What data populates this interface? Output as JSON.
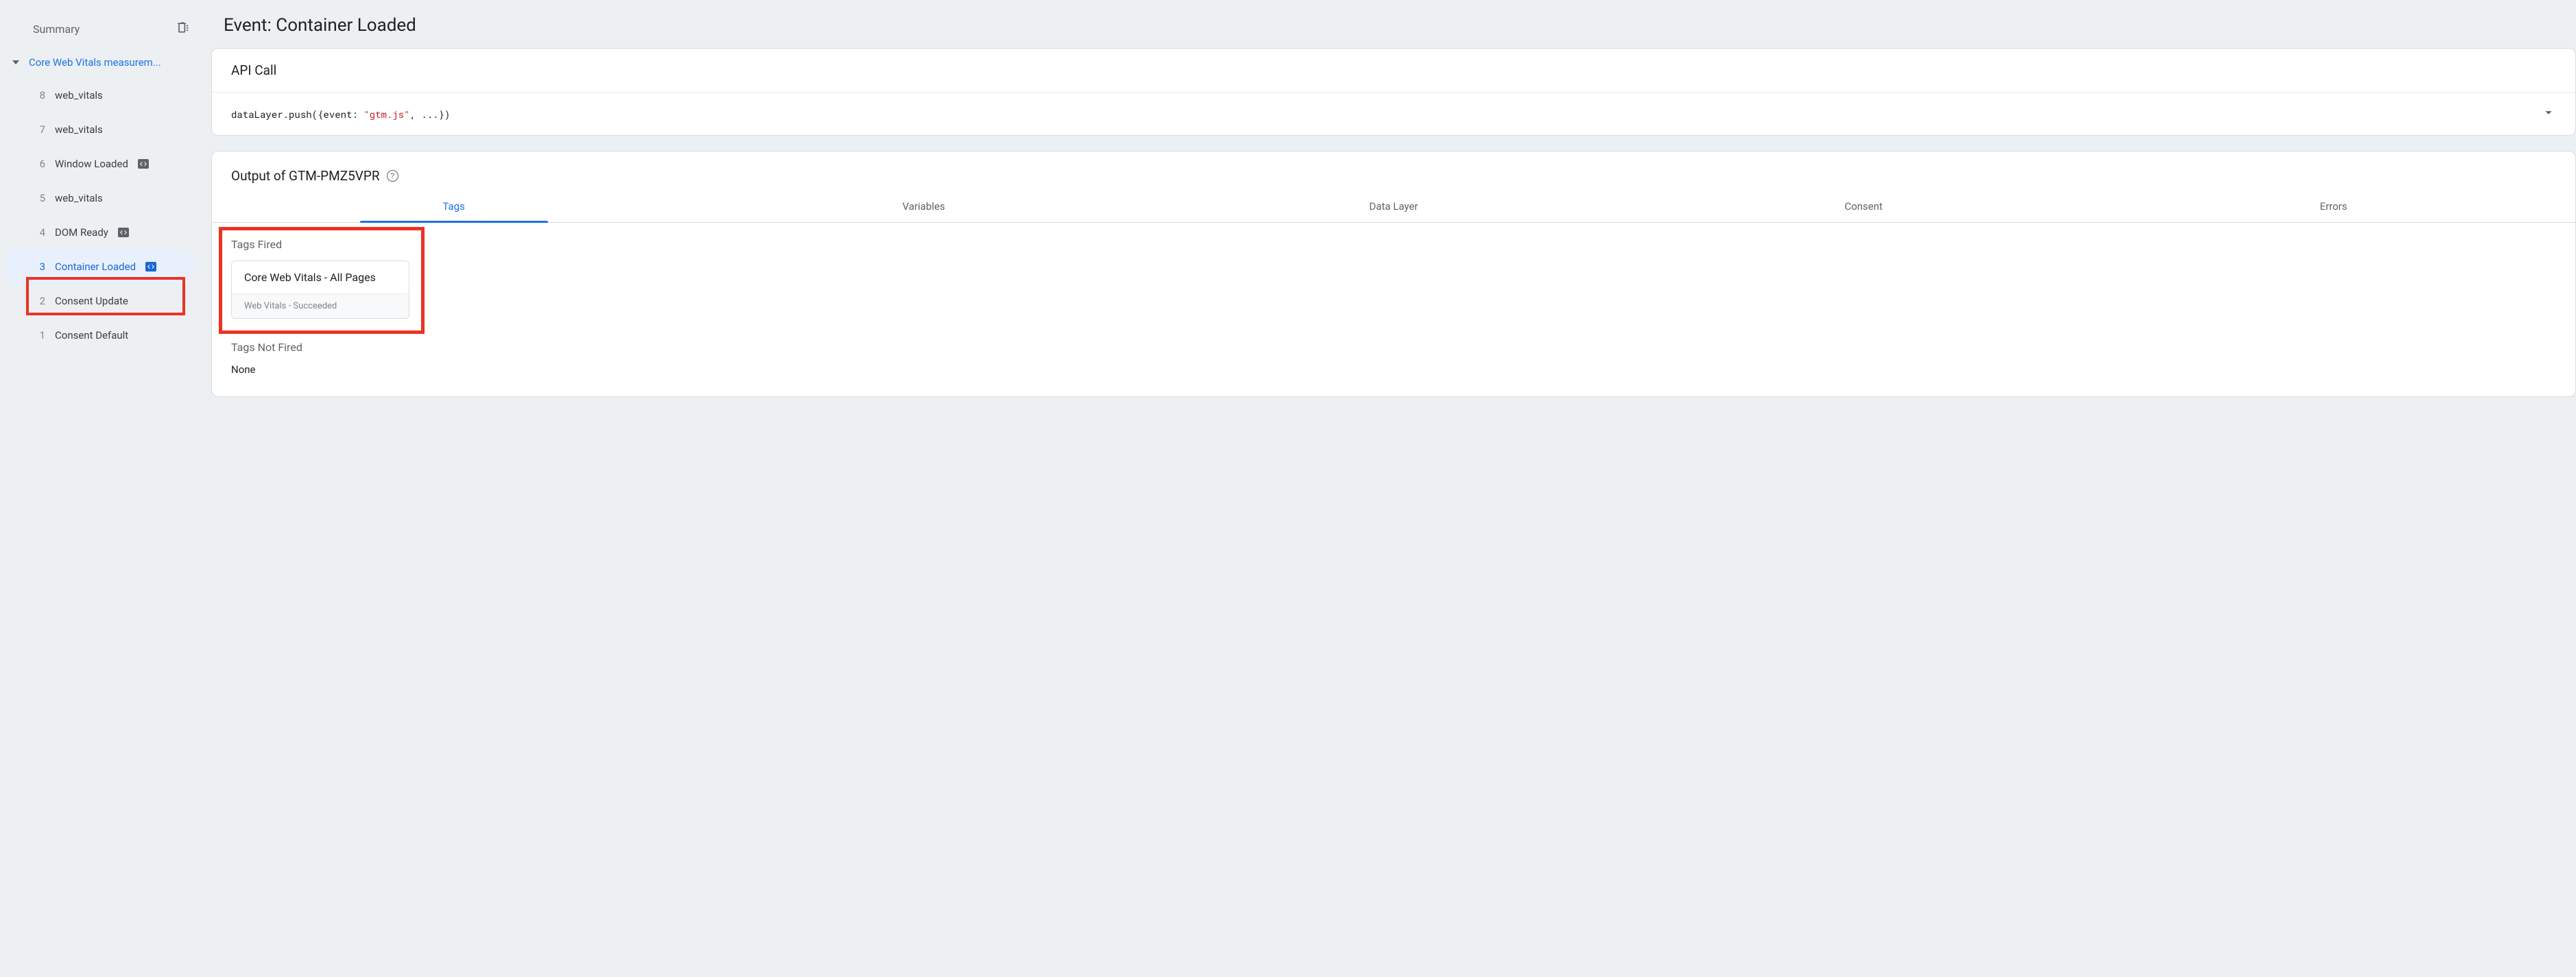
{
  "sidebar": {
    "summary_label": "Summary",
    "container_label": "Core Web Vitals measurem...",
    "events": [
      {
        "num": "8",
        "label": "web_vitals",
        "badge": false,
        "selected": false
      },
      {
        "num": "7",
        "label": "web_vitals",
        "badge": false,
        "selected": false
      },
      {
        "num": "6",
        "label": "Window Loaded",
        "badge": true,
        "selected": false
      },
      {
        "num": "5",
        "label": "web_vitals",
        "badge": false,
        "selected": false
      },
      {
        "num": "4",
        "label": "DOM Ready",
        "badge": true,
        "selected": false
      },
      {
        "num": "3",
        "label": "Container Loaded",
        "badge": true,
        "selected": true
      },
      {
        "num": "2",
        "label": "Consent Update",
        "badge": false,
        "selected": false
      },
      {
        "num": "1",
        "label": "Consent Default",
        "badge": false,
        "selected": false
      }
    ]
  },
  "main": {
    "title": "Event: Container Loaded",
    "api_call": {
      "header": "API Call",
      "prefix": "dataLayer.push({event: ",
      "value": "\"gtm.js\"",
      "suffix": ", ...})"
    },
    "output": {
      "header_prefix": "Output of ",
      "container_id": "GTM-PMZ5VPR",
      "tabs": [
        "Tags",
        "Variables",
        "Data Layer",
        "Consent",
        "Errors"
      ],
      "active_tab": "Tags",
      "fired_label": "Tags Fired",
      "fired_tag": {
        "title": "Core Web Vitals - All Pages",
        "subtitle": "Web Vitals - Succeeded"
      },
      "not_fired_label": "Tags Not Fired",
      "not_fired_value": "None"
    }
  }
}
